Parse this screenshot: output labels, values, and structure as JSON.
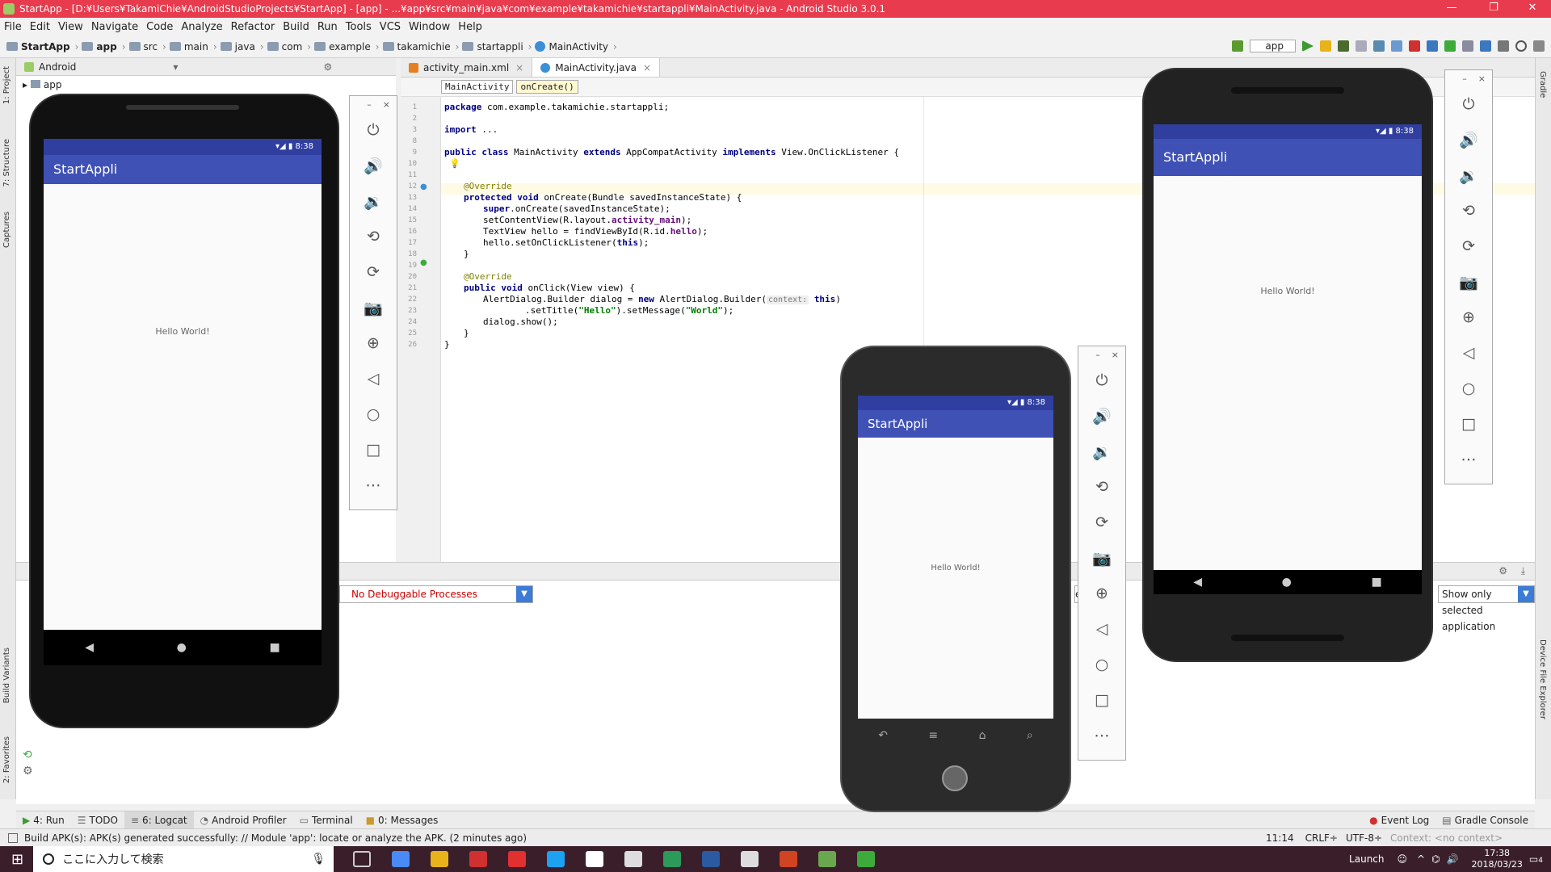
{
  "window": {
    "title": "StartApp - [D:¥Users¥TakamiChie¥AndroidStudioProjects¥StartApp] - [app] - ...¥app¥src¥main¥java¥com¥example¥takamichie¥startappli¥MainActivity.java - Android Studio 3.0.1"
  },
  "menu": [
    "File",
    "Edit",
    "View",
    "Navigate",
    "Code",
    "Analyze",
    "Refactor",
    "Build",
    "Run",
    "Tools",
    "VCS",
    "Window",
    "Help"
  ],
  "breadcrumb": [
    "StartApp",
    "app",
    "src",
    "main",
    "java",
    "com",
    "example",
    "takamichie",
    "startappli",
    "MainActivity"
  ],
  "run_config": "app",
  "project": {
    "view": "Android",
    "root": "app"
  },
  "editor": {
    "tabs": [
      "activity_main.xml",
      "MainActivity.java"
    ],
    "crumbs": [
      "MainActivity",
      "onCreate()"
    ],
    "line_numbers": [
      "1",
      "2",
      "3",
      "8",
      "9",
      "10",
      "11",
      "12",
      "13",
      "14",
      "15",
      "16",
      "17",
      "18",
      "19",
      "20",
      "21",
      "22",
      "23",
      "24",
      "25",
      "26"
    ],
    "code": {
      "l1_kw": "package",
      "l1_rest": " com.example.takamichie.startappli;",
      "l3_kw": "import",
      "l3_rest": " ...",
      "l9_a": "public class",
      "l9_b": " MainActivity ",
      "l9_c": "extends",
      "l9_d": " AppCompatActivity ",
      "l9_e": "implements",
      "l9_f": " View.OnClickListener {",
      "l11": "@Override",
      "l12_a": "protected void",
      "l12_b": " onCreate(Bundle savedInstanceState) {",
      "l13_a": "super",
      "l13_b": ".onCreate(savedInstanceState);",
      "l14_a": "setContentView(R.layout.",
      "l14_b": "activity_main",
      "l14_c": ");",
      "l15_a": "TextView hello = findViewById(R.id.",
      "l15_b": "hello",
      "l15_c": ");",
      "l16_a": "hello.setOnClickListener(",
      "l16_b": "this",
      "l16_c": ");",
      "l17": "}",
      "l19": "@Override",
      "l20_a": "public void",
      "l20_b": " onClick(View view) {",
      "l21_a": "AlertDialog.Builder dialog = ",
      "l21_b": "new",
      "l21_c": " AlertDialog.Builder(",
      "l21_hint": "context:",
      "l21_d": "this",
      "l21_e": ")",
      "l22_a": ".setTitle(",
      "l22_b": "\"Hello\"",
      "l22_c": ").setMessage(",
      "l22_d": "\"World\"",
      "l22_e": ");",
      "l23": "dialog.show();",
      "l24": "}",
      "l25": "}"
    }
  },
  "logcat": {
    "process": "No Debuggable Processes",
    "filter": "Show only selected application",
    "mid": "er"
  },
  "left_strip": [
    "1: Project",
    "7: Structure",
    "Captures",
    "Build Variants",
    "2: Favorites"
  ],
  "right_strip": [
    "Gradle",
    "Device File Explorer"
  ],
  "bottom_tabs": [
    "4: Run",
    "TODO",
    "6: Logcat",
    "Android Profiler",
    "Terminal",
    "0: Messages"
  ],
  "bottom_right_tabs": [
    "Event Log",
    "Gradle Console"
  ],
  "status": {
    "message": "Build APK(s): APK(s) generated successfully: // Module 'app': locate or analyze the APK. (2 minutes ago)",
    "pos": "11:14",
    "crlf": "CRLF÷",
    "enc": "UTF-8÷",
    "ctx": "Context: <no context>"
  },
  "phones": [
    {
      "time": "8:38",
      "app": "StartAppli",
      "text": "Hello World!"
    },
    {
      "time": "8:38",
      "app": "StartAppli",
      "text": "Hello World!"
    },
    {
      "time": "8:38",
      "app": "StartAppli",
      "text": "Hello World!"
    }
  ],
  "taskbar": {
    "search": "ここに入力して検索",
    "launch": "Launch",
    "time": "17:38",
    "date": "2018/03/23",
    "notif": "4"
  }
}
